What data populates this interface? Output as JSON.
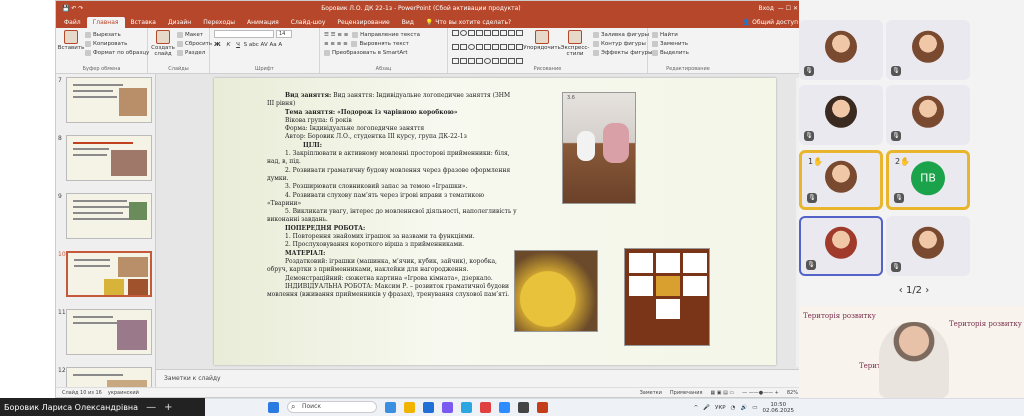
{
  "window": {
    "title": "Боровик Л.О. ДК 22-1з - PowerPoint (Сбой активации продукта)",
    "search_placeholder": "Что вы хотите сделать?",
    "login": "Вход"
  },
  "tabs": [
    "Файл",
    "Главная",
    "Вставка",
    "Дизайн",
    "Переходы",
    "Анимация",
    "Слайд-шоу",
    "Рецензирование",
    "Вид"
  ],
  "tabs_active": "Главная",
  "share": "Общий доступ",
  "ribbon": {
    "clipboard": {
      "paste": "Вставить",
      "cut": "Вырезать",
      "copy": "Копировать",
      "format_painter": "Формат по образцу",
      "group": "Буфер обмена"
    },
    "slides": {
      "create": "Создать слайд",
      "layout": "Макет",
      "reset": "Сбросить",
      "section": "Раздел",
      "group": "Слайды"
    },
    "font": {
      "name": "",
      "size": "14",
      "group": "Шрифт"
    },
    "paragraph": {
      "direction": "Направление текста",
      "align": "Выровнять текст",
      "smartart": "Преобразовать в SmartArt",
      "group": "Абзац"
    },
    "drawing": {
      "arrange": "Упорядочить",
      "quick_styles": "Экспресс-стили",
      "fill": "Заливка фигуры",
      "outline": "Контур фигуры",
      "effects": "Эффекты фигуры",
      "group": "Рисование"
    },
    "editing": {
      "find": "Найти",
      "replace": "Заменить",
      "select": "Выделить",
      "group": "Редактирование"
    }
  },
  "thumbnails": [
    {
      "num": "7"
    },
    {
      "num": "8"
    },
    {
      "num": "9"
    },
    {
      "num": "10"
    },
    {
      "num": "11"
    },
    {
      "num": "12"
    }
  ],
  "slide": {
    "lines": [
      "Вид заняття: Індивідуальне логопедичне заняття (ЗНМ ІІІ рівня)",
      "Тема заняття: «Подорож із чарівною коробкою»",
      "Вікова група: 6 років",
      "Форма: Індивідуальне логопедичне заняття",
      "Автор: Боровик Л.О., студентка ІІІ курсу, група ДК-22-1з",
      "ЦІЛІ:",
      "1. Закріплювати в активному мовленні просторові прийменники: біля, над, в, під.",
      "2. Розвивати граматичну будову мовлення через фразове оформлення думки.",
      "3. Розширювати словниковий запас за темою «Іграшки».",
      "4. Розвивати слухову пам’ять через ігрові вправи з тематикою «Тварини»",
      "5. Викликати увагу, інтерес до мовленнєвої діяльності, наполегливість у виконанні завдань.",
      "ПОПЕРЕДНЯ РОБОТА:",
      "1. Повторення знайомих іграшок за назвами та функціями.",
      "2. Прослуховування короткого вірша з прийменниками.",
      "МАТЕРІАЛ:",
      "Роздатковий: іграшки (машинка, м’ячик, кубик, зайчик), коробка, обруч, картки з прийменниками, наклейки для нагородження.",
      "Демонстраційний: сюжетна картина «Ігрова кімната», дзеркало.",
      "ІНДИВІДУАЛЬНА РОБОТА: Максим Р. – розвиток граматичної будови",
      "мовлення (вживання прийменників у фразах), тренування слухової пам’яті."
    ],
    "photo_label": "3.6"
  },
  "notes_placeholder": "Заметки к слайду",
  "status": {
    "slide": "Слайд 10 из 16",
    "lang": "украинский",
    "notes": "Заметки",
    "comments": "Примечания",
    "zoom": "82%"
  },
  "user_name": "Боровик Лариса Олександрівна",
  "taskbar": {
    "search": "Поиск",
    "lang": "УКР",
    "time": "10:50",
    "date": "02.06.2025"
  },
  "zoom_panel": {
    "pager": "1/2",
    "tiles": [
      {
        "hand": ""
      },
      {
        "hand": ""
      },
      {
        "hand": ""
      },
      {
        "hand": ""
      },
      {
        "hand": "1"
      },
      {
        "hand": "2",
        "initials": "ПВ"
      },
      {
        "hand": ""
      },
      {
        "hand": ""
      }
    ]
  },
  "camera_signs": [
    "Територія розвитку",
    "Територія розвитку",
    "Територія розвитку"
  ]
}
